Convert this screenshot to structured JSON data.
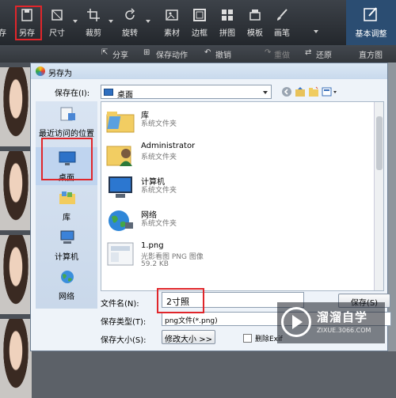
{
  "toolbar": {
    "items": [
      {
        "label": "存",
        "icon": "partial-icon"
      },
      {
        "label": "另存",
        "icon": "save-as-icon"
      },
      {
        "label": "尺寸",
        "icon": "resize-icon"
      },
      {
        "label": "裁剪",
        "icon": "crop-icon"
      },
      {
        "label": "旋转",
        "icon": "rotate-icon"
      },
      {
        "label": "素材",
        "icon": "material-icon"
      },
      {
        "label": "边框",
        "icon": "frame-icon"
      },
      {
        "label": "拼图",
        "icon": "collage-icon"
      },
      {
        "label": "模板",
        "icon": "template-icon"
      },
      {
        "label": "画笔",
        "icon": "brush-icon"
      }
    ],
    "basic_adjust": "基本调整"
  },
  "subbar": {
    "share": "分享",
    "save_action": "保存动作",
    "undo": "撤销",
    "redo": "重做",
    "restore": "还原",
    "histogram": "直方图"
  },
  "dialog": {
    "title": "另存为",
    "save_in_label": "保存在(I):",
    "save_in_value": "桌面",
    "places": [
      {
        "label": "最近访问的位置"
      },
      {
        "label": "桌面"
      },
      {
        "label": "库"
      },
      {
        "label": "计算机"
      },
      {
        "label": "网络"
      }
    ],
    "files": [
      {
        "name": "库",
        "desc": "系统文件夹",
        "extra": ""
      },
      {
        "name": "Administrator",
        "desc": "系统文件夹",
        "extra": ""
      },
      {
        "name": "计算机",
        "desc": "系统文件夹",
        "extra": ""
      },
      {
        "name": "网络",
        "desc": "系统文件夹",
        "extra": ""
      },
      {
        "name": "1.png",
        "desc": "光影看图 PNG 图像",
        "extra": "59.2 KB"
      }
    ],
    "filename_label": "文件名(N):",
    "filename_value": "2寸照",
    "filetype_label": "保存类型(T):",
    "filetype_value": "png文件(*.png)",
    "size_label": "保存大小(S):",
    "resize_button": "修改大小 >>",
    "save_button": "保存(S)",
    "delete_exif_label": "删除Exif"
  },
  "watermark": {
    "title": "溜溜自学",
    "url": "ZIXUE.3066.COM"
  },
  "colors": {
    "highlight_box": "#e0262b",
    "toolbar_bg": "#2b2f34",
    "basic_adjust_bg": "#2b4d72"
  }
}
